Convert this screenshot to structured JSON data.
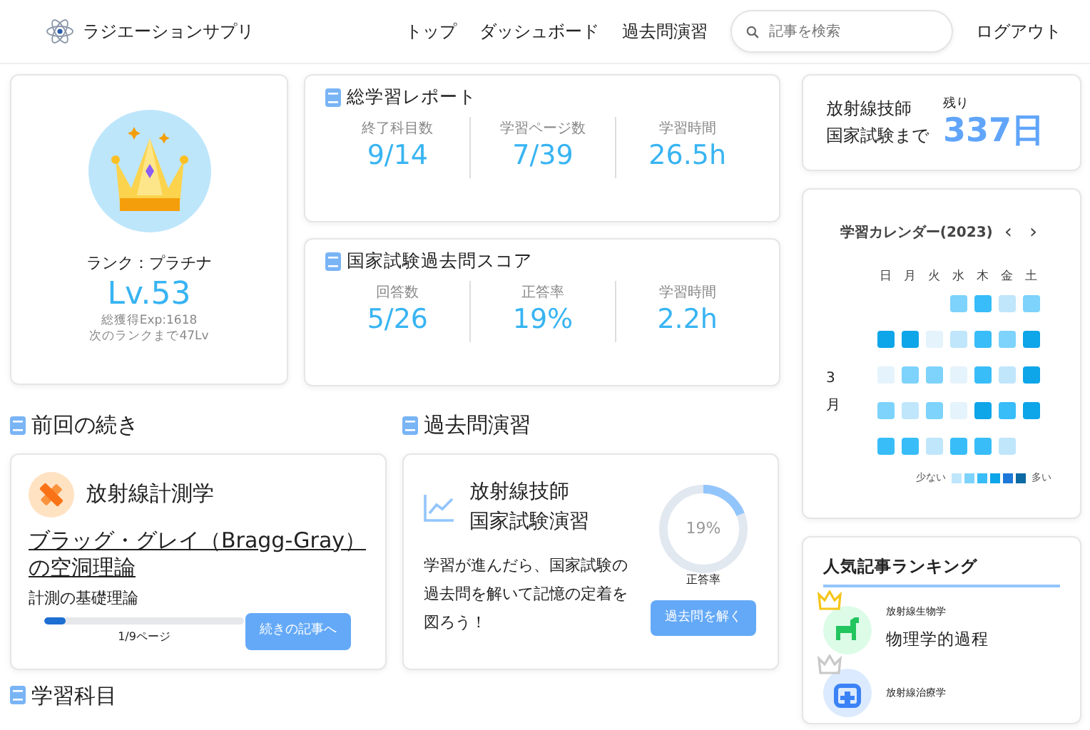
{
  "navbar": {
    "brand": "ラジエーションサプリ",
    "links": [
      "トップ",
      "ダッシュボード",
      "過去問演習"
    ],
    "search": {
      "placeholder": "記事を検索"
    },
    "logout": "ログアウト"
  },
  "rank": {
    "label": "ランク：プラチナ",
    "level": "Lv.53",
    "exp": "総獲得Exp:1618",
    "next": "次のランクまで47Lv"
  },
  "reports": [
    {
      "title": "総学習レポート",
      "stats": [
        {
          "label": "終了科目数",
          "value": "9/14"
        },
        {
          "label": "学習ページ数",
          "value": "7/39"
        },
        {
          "label": "学習時間",
          "value": "26.5h"
        }
      ]
    },
    {
      "title": "国家試験過去問スコア",
      "stats": [
        {
          "label": "回答数",
          "value": "5/26"
        },
        {
          "label": "正答率",
          "value": "19%"
        },
        {
          "label": "学習時間",
          "value": "2.2h"
        }
      ]
    }
  ],
  "countdown": {
    "label_lines": [
      "放射線技師",
      "国家試験まで"
    ],
    "remaining_label": "残り",
    "days": "337日"
  },
  "calendar": {
    "title": "学習カレンダー(2023)",
    "prev": "‹",
    "next": "›",
    "weekdays": [
      "日",
      "月",
      "火",
      "水",
      "木",
      "金",
      "土"
    ],
    "month": "3月",
    "weeks": [
      {
        "days": [
          {
            "kind": "blank"
          },
          {
            "kind": "blank"
          },
          {
            "kind": "blank"
          },
          {
            "kind": "day",
            "color": "#7dd3fc"
          },
          {
            "kind": "day",
            "color": "#38bdf8"
          },
          {
            "kind": "day",
            "color": "#bfe6fb"
          },
          {
            "kind": "day",
            "color": "#7dd3fc"
          }
        ]
      },
      {
        "days": [
          {
            "kind": "day",
            "color": "#0ea5e9"
          },
          {
            "kind": "day",
            "color": "#0ea5e9"
          },
          {
            "kind": "day",
            "color": "#e4f3fc"
          },
          {
            "kind": "day",
            "color": "#bfe6fb"
          },
          {
            "kind": "day",
            "color": "#38bdf8"
          },
          {
            "kind": "day",
            "color": "#7dd3fc"
          },
          {
            "kind": "day",
            "color": "#0ea5e9"
          }
        ]
      },
      {
        "days": [
          {
            "kind": "day",
            "color": "#e4f3fc"
          },
          {
            "kind": "day",
            "color": "#7dd3fc"
          },
          {
            "kind": "day",
            "color": "#7dd3fc"
          },
          {
            "kind": "day",
            "color": "#e4f3fc"
          },
          {
            "kind": "day",
            "color": "#38bdf8"
          },
          {
            "kind": "day",
            "color": "#bfe6fb"
          },
          {
            "kind": "day",
            "color": "#0ea5e9"
          }
        ]
      },
      {
        "days": [
          {
            "kind": "day",
            "color": "#7dd3fc"
          },
          {
            "kind": "day",
            "color": "#bfe6fb"
          },
          {
            "kind": "day",
            "color": "#7dd3fc"
          },
          {
            "kind": "day",
            "color": "#e4f3fc"
          },
          {
            "kind": "day",
            "color": "#0ea5e9"
          },
          {
            "kind": "day",
            "color": "#38bdf8"
          },
          {
            "kind": "day",
            "color": "#0ea5e9"
          }
        ]
      },
      {
        "days": [
          {
            "kind": "day",
            "color": "#38bdf8"
          },
          {
            "kind": "day",
            "color": "#38bdf8"
          },
          {
            "kind": "day",
            "color": "#bfe6fb"
          },
          {
            "kind": "day",
            "color": "#38bdf8"
          },
          {
            "kind": "day",
            "color": "#38bdf8"
          },
          {
            "kind": "day",
            "color": "#bfe6fb"
          },
          {
            "kind": "blank"
          }
        ]
      }
    ],
    "legend_low": "少ない",
    "legend": [
      {
        "color": "#bfe6fb"
      },
      {
        "color": "#7dd3fc"
      },
      {
        "color": "#38bdf8"
      },
      {
        "color": "#0ea5e9"
      },
      {
        "color": "#1d78d8"
      },
      {
        "color": "#0b69a3"
      }
    ],
    "legend_high": "多い"
  },
  "continue": {
    "heading": "前回の続き",
    "subject": "放射線計測学",
    "article": "ブラッグ・グレイ（Bragg-Gray）の空洞理論",
    "subtitle": "計測の基礎理論",
    "level": 0.11,
    "progress_text": "1/9ページ",
    "button": "続きの記事へ"
  },
  "past_exam": {
    "heading": "過去問演習",
    "title_lines": [
      "放射線技師",
      "国家試験演習"
    ],
    "description": "学習が進んだら、国家試験の過去問を解いて記憶の定着を図ろう！",
    "level": 0.19,
    "donut_text": "19%",
    "donut_caption": "正答率",
    "button": "過去問を解く"
  },
  "ranking": {
    "title": "人気記事ランキング",
    "items": [
      {
        "color": "#f5c518",
        "kind": "dog",
        "category": "放射線生物学",
        "title": "物理学的過程"
      },
      {
        "color": "#c8c8c8",
        "kind": "medical",
        "category": "放射線治療学"
      }
    ]
  },
  "subjects": {
    "heading": "学習科目"
  }
}
